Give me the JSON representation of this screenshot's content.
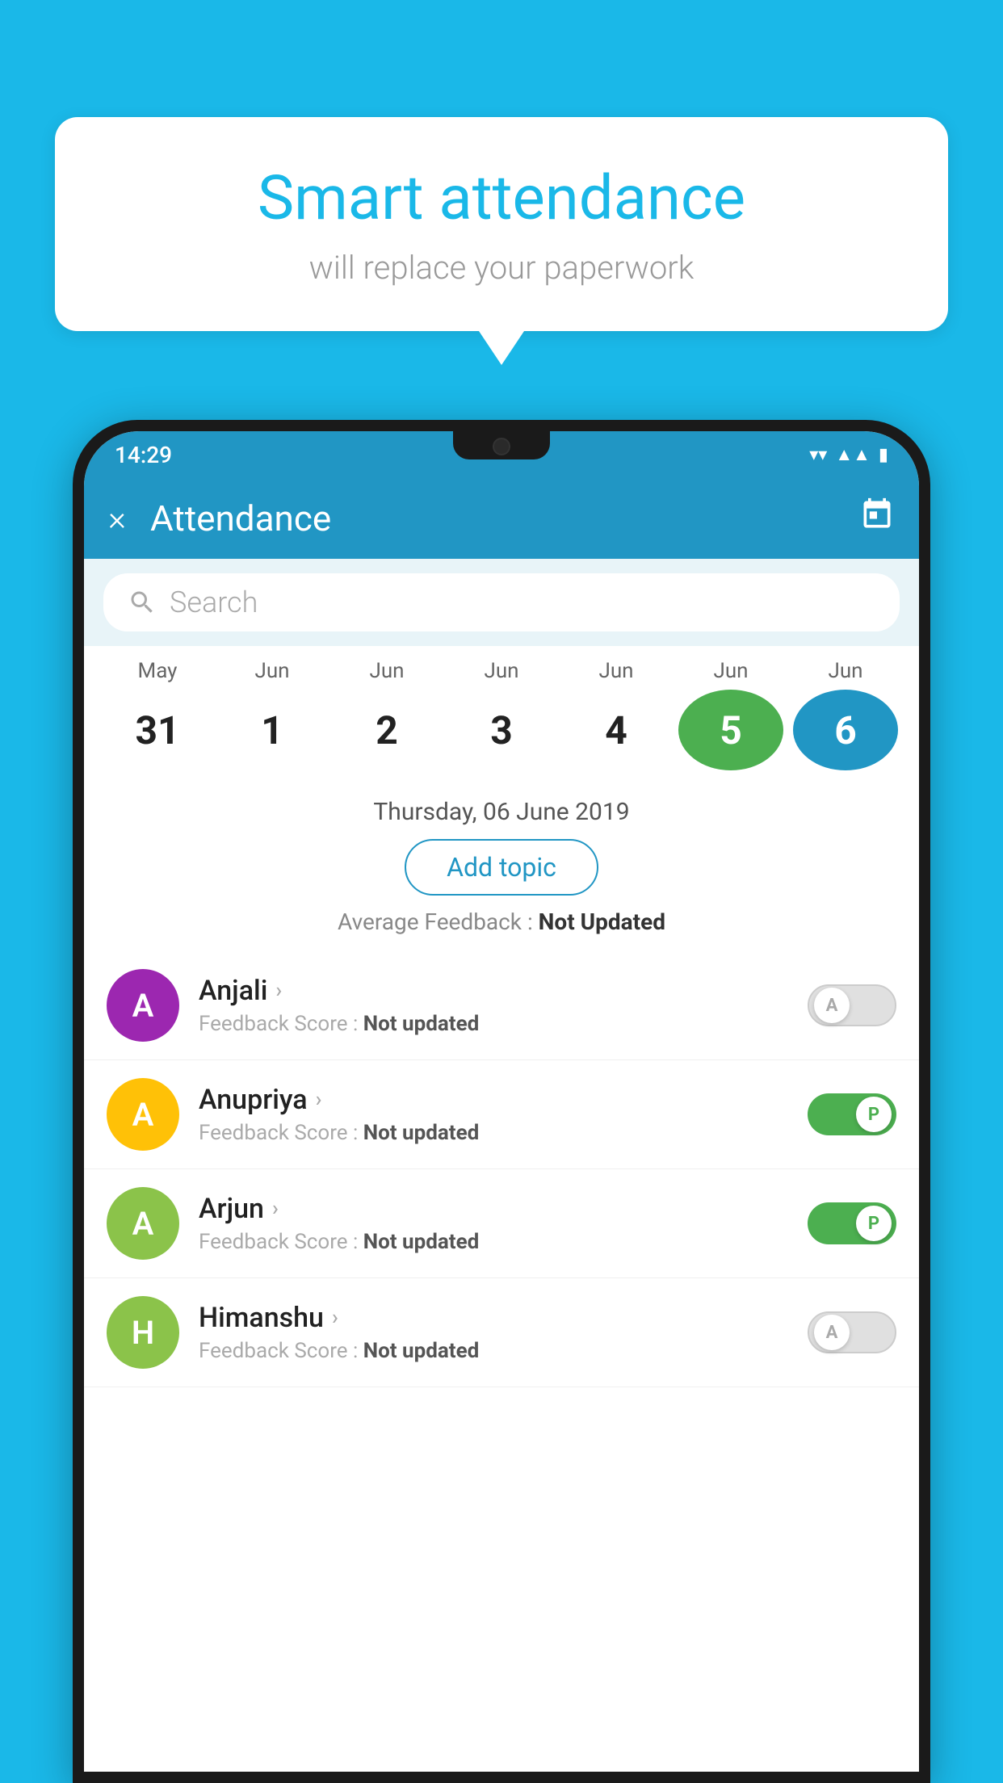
{
  "background_color": "#1ab8e8",
  "bubble": {
    "title": "Smart attendance",
    "subtitle": "will replace your paperwork"
  },
  "status_bar": {
    "time": "14:29",
    "icons": [
      "wifi",
      "signal",
      "battery"
    ]
  },
  "app_bar": {
    "title": "Attendance",
    "close_label": "×",
    "calendar_icon": "📅"
  },
  "search": {
    "placeholder": "Search"
  },
  "calendar": {
    "months": [
      "May",
      "Jun",
      "Jun",
      "Jun",
      "Jun",
      "Jun",
      "Jun"
    ],
    "dates": [
      "31",
      "1",
      "2",
      "3",
      "4",
      "5",
      "6"
    ],
    "today_index": 5,
    "selected_index": 6
  },
  "selected_date": {
    "display": "Thursday, 06 June 2019",
    "add_topic_label": "Add topic",
    "avg_feedback_label": "Average Feedback : ",
    "avg_feedback_value": "Not Updated"
  },
  "students": [
    {
      "name": "Anjali",
      "avatar_letter": "A",
      "avatar_color": "#9c27b0",
      "feedback": "Not updated",
      "attendance": "A",
      "toggle_state": "off"
    },
    {
      "name": "Anupriya",
      "avatar_letter": "A",
      "avatar_color": "#ffc107",
      "feedback": "Not updated",
      "attendance": "P",
      "toggle_state": "on"
    },
    {
      "name": "Arjun",
      "avatar_letter": "A",
      "avatar_color": "#8bc34a",
      "feedback": "Not updated",
      "attendance": "P",
      "toggle_state": "on"
    },
    {
      "name": "Himanshu",
      "avatar_letter": "H",
      "avatar_color": "#8bc34a",
      "feedback": "Not updated",
      "attendance": "A",
      "toggle_state": "off"
    }
  ],
  "feedback_label": "Feedback Score : "
}
